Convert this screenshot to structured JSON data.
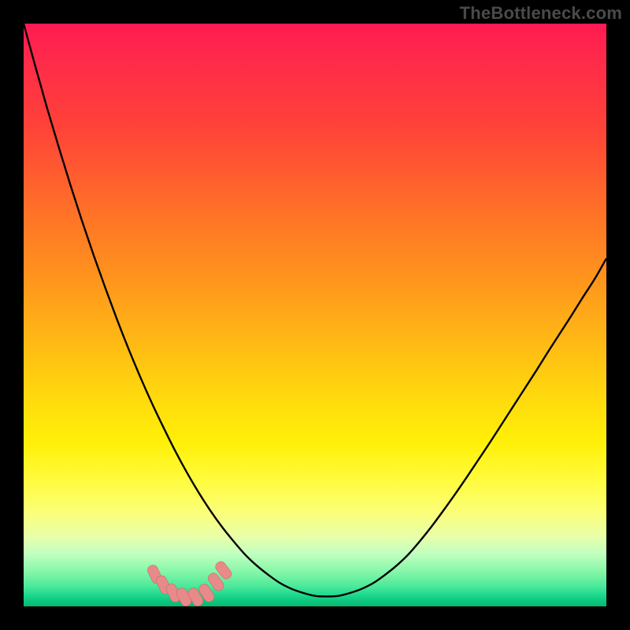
{
  "watermark": "TheBottleneck.com",
  "colors": {
    "black": "#000000",
    "curve": "#000000",
    "marker_fill": "#e88a8a",
    "marker_stroke": "#c86a6a",
    "watermark": "#4a4a4a"
  },
  "chart_data": {
    "type": "line",
    "title": "",
    "xlabel": "",
    "ylabel": "",
    "xlim": [
      0,
      100
    ],
    "ylim": [
      0,
      100
    ],
    "x": [
      0,
      2,
      4,
      6,
      8,
      10,
      12,
      14,
      16,
      18,
      20,
      22,
      24,
      26,
      28,
      30,
      32,
      34,
      36,
      38,
      40,
      42,
      44,
      46,
      48,
      50,
      52,
      54,
      56,
      58,
      60,
      62,
      64,
      66,
      68,
      70,
      72,
      74,
      76,
      78,
      80,
      82,
      84,
      86,
      88,
      90,
      92,
      94,
      96,
      98,
      100
    ],
    "values": [
      100,
      92.7,
      85.6,
      78.9,
      72.4,
      66.2,
      60.3,
      54.7,
      49.3,
      44.2,
      39.4,
      34.9,
      30.7,
      26.7,
      23.0,
      19.6,
      16.5,
      13.7,
      11.2,
      8.9,
      7.0,
      5.4,
      4.0,
      3.0,
      2.3,
      1.8,
      1.7,
      1.8,
      2.3,
      3.0,
      4.0,
      5.4,
      7.0,
      8.9,
      11.2,
      13.7,
      16.4,
      19.2,
      22.1,
      25.1,
      28.1,
      31.2,
      34.3,
      37.4,
      40.5,
      43.7,
      46.8,
      49.9,
      53.1,
      56.2,
      59.7
    ],
    "series": [
      {
        "name": "bottleneck-curve",
        "x": [
          0,
          2,
          4,
          6,
          8,
          10,
          12,
          14,
          16,
          18,
          20,
          22,
          24,
          26,
          28,
          30,
          32,
          34,
          36,
          38,
          40,
          42,
          44,
          46,
          48,
          50,
          52,
          54,
          56,
          58,
          60,
          62,
          64,
          66,
          68,
          70,
          72,
          74,
          76,
          78,
          80,
          82,
          84,
          86,
          88,
          90,
          92,
          94,
          96,
          98,
          100
        ],
        "y": [
          100,
          92.7,
          85.6,
          78.9,
          72.4,
          66.2,
          60.3,
          54.7,
          49.3,
          44.2,
          39.4,
          34.9,
          30.7,
          26.7,
          23.0,
          19.6,
          16.5,
          13.7,
          11.2,
          8.9,
          7.0,
          5.4,
          4.0,
          3.0,
          2.3,
          1.8,
          1.7,
          1.8,
          2.3,
          3.0,
          4.0,
          5.4,
          7.0,
          8.9,
          11.2,
          13.7,
          16.4,
          19.2,
          22.1,
          25.1,
          28.1,
          31.2,
          34.3,
          37.4,
          40.5,
          43.7,
          46.8,
          49.9,
          53.1,
          56.2,
          59.7
        ]
      }
    ],
    "markers": [
      {
        "x": 22.5,
        "y": 5.5,
        "scale": 1.0
      },
      {
        "x": 24.0,
        "y": 3.7,
        "scale": 1.0
      },
      {
        "x": 25.7,
        "y": 2.3,
        "scale": 1.0
      },
      {
        "x": 27.5,
        "y": 1.6,
        "scale": 1.0
      },
      {
        "x": 29.5,
        "y": 1.6,
        "scale": 1.0
      },
      {
        "x": 31.4,
        "y": 2.3,
        "scale": 1.0
      },
      {
        "x": 33.0,
        "y": 4.2,
        "scale": 1.0
      },
      {
        "x": 34.3,
        "y": 6.2,
        "scale": 1.0
      }
    ],
    "annotations": []
  }
}
